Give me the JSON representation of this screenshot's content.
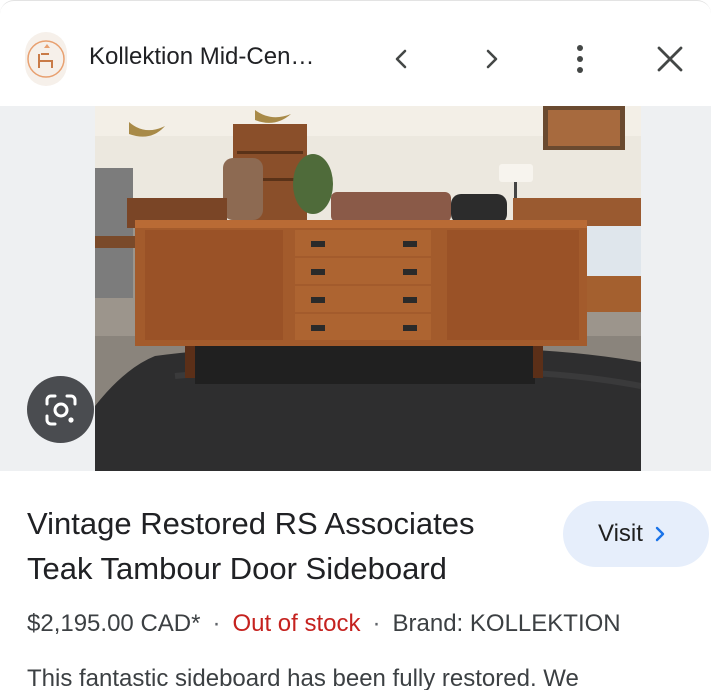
{
  "header": {
    "site_title": "Kollektion Mid-Cen…",
    "favicon_icon": "chair-logo-icon",
    "prev_icon": "chevron-left-icon",
    "next_icon": "chevron-right-icon",
    "more_icon": "more-vert-icon",
    "close_icon": "close-icon"
  },
  "image": {
    "lens_icon": "google-lens-icon"
  },
  "product": {
    "title": "Vintage Restored RS Associates Teak Tambour Door Sideboard",
    "visit_label": "Visit",
    "price": "$2,195.00 CAD*",
    "separator": "·",
    "stock_status": "Out of stock",
    "brand": "Brand: KOLLEKTION",
    "description": "This fantastic sideboard has been fully restored. We"
  },
  "colors": {
    "accent_button_bg": "#e6eefb",
    "stock_red": "#c5221f",
    "link_blue": "#1a73e8"
  }
}
